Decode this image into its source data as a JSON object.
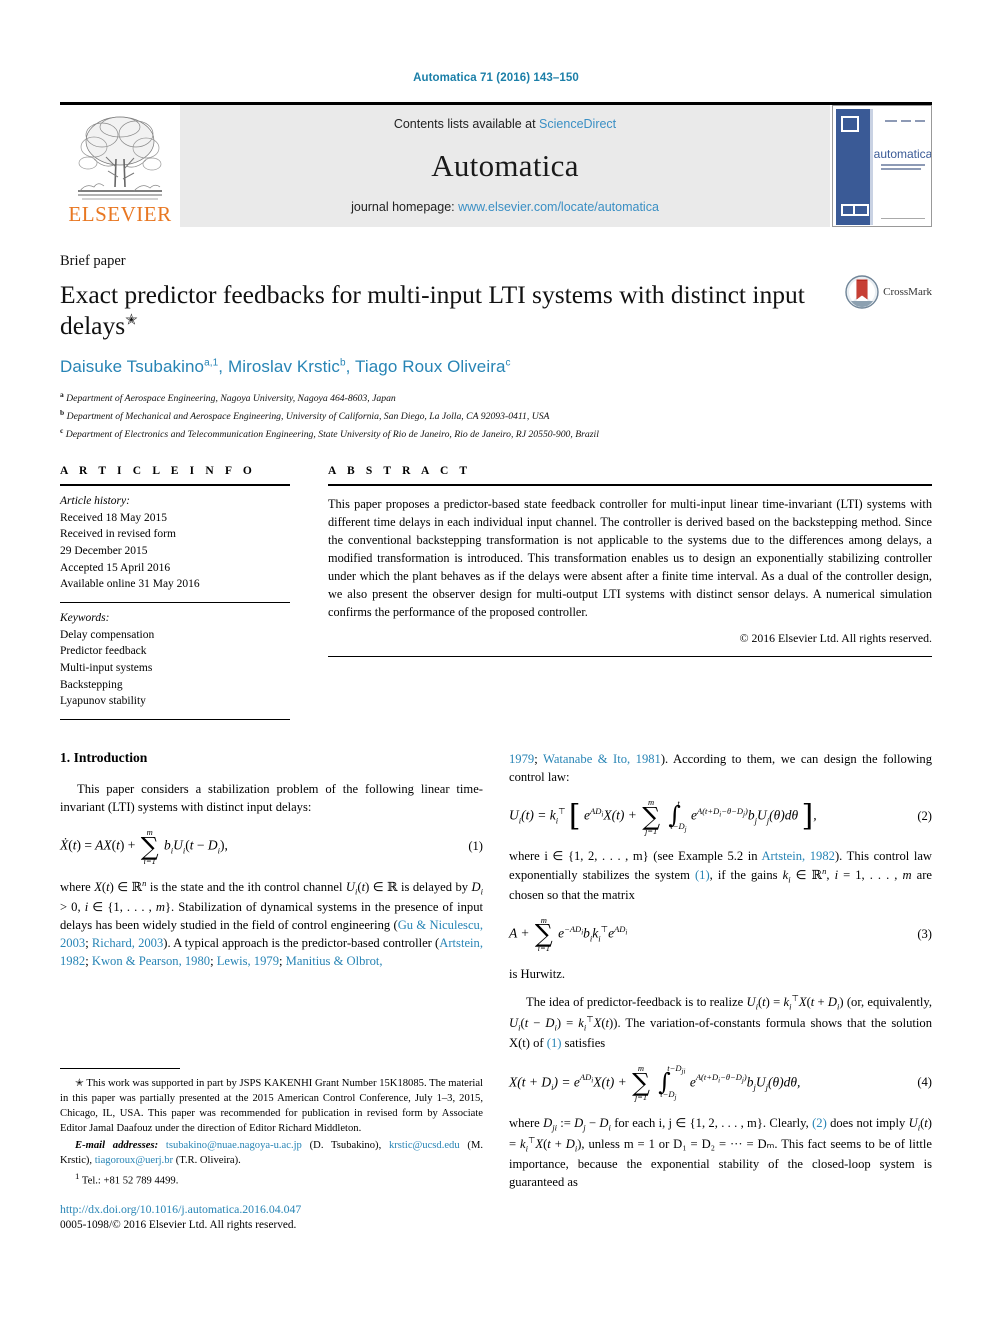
{
  "running_head": "Automatica 71 (2016) 143–150",
  "masthead": {
    "contents_prefix": "Contents lists available at ",
    "sciencedirect": "ScienceDirect",
    "journal_title": "Automatica",
    "homepage_prefix": "journal homepage: ",
    "homepage_url": "www.elsevier.com/locate/automatica",
    "publisher": "ELSEVIER",
    "cover_title": "automatica",
    "cover_subtitle": "A Journal of IFAC the International Federation of Automatic Control",
    "accent_blue": "#2784b5",
    "elsevier_orange": "#e87722"
  },
  "title_block": {
    "article_type": "Brief paper",
    "title": "Exact predictor feedbacks for multi-input LTI systems with distinct input delays",
    "title_marker": "✭",
    "crossmark_label": "CrossMark",
    "authors": [
      {
        "name": "Daisuke Tsubakino",
        "marks": "a,1"
      },
      {
        "name": "Miroslav Krstic",
        "marks": "b"
      },
      {
        "name": "Tiago Roux Oliveira",
        "marks": "c"
      }
    ],
    "affiliations": [
      {
        "mark": "a",
        "text": "Department of Aerospace Engineering, Nagoya University, Nagoya 464-8603, Japan"
      },
      {
        "mark": "b",
        "text": "Department of Mechanical and Aerospace Engineering, University of California, San Diego, La Jolla, CA 92093-0411, USA"
      },
      {
        "mark": "c",
        "text": "Department of Electronics and Telecommunication Engineering, State University of Rio de Janeiro, Rio de Janeiro, RJ 20550-900, Brazil"
      }
    ]
  },
  "article_info": {
    "heading": "A R T I C L E   I N F O",
    "history_label": "Article history:",
    "history": [
      "Received 18 May 2015",
      "Received in revised form",
      "29 December 2015",
      "Accepted 15 April 2016",
      "Available online 31 May 2016"
    ],
    "keywords_label": "Keywords:",
    "keywords": [
      "Delay compensation",
      "Predictor feedback",
      "Multi-input systems",
      "Backstepping",
      "Lyapunov stability"
    ]
  },
  "abstract": {
    "heading": "A B S T R A C T",
    "text": "This paper proposes a predictor-based state feedback controller for multi-input linear time-invariant (LTI) systems with different time delays in each individual input channel. The controller is derived based on the backstepping method. Since the conventional backstepping transformation is not applicable to the systems due to the differences among delays, a modified transformation is introduced. This transformation enables us to design an exponentially stabilizing controller under which the plant behaves as if the delays were absent after a finite time interval. As a dual of the controller design, we also present the observer design for multi-output LTI systems with distinct sensor delays. A numerical simulation confirms the performance of the proposed controller.",
    "copyright": "© 2016 Elsevier Ltd. All rights reserved."
  },
  "body": {
    "section1_title": "1. Introduction",
    "left": {
      "para1_a": "This paper considers a stabilization problem of the following linear time-invariant (LTI) systems with distinct input delays:",
      "eq1_num": "(1)",
      "para2_a": "where ",
      "para2_b": " is the state and the ith control channel ",
      "para2_c": " is delayed by ",
      "para2_d": ". Stabilization of dynamical systems in the presence of input delays has been widely studied in the field of control engineering (",
      "ref_gu": "Gu & Niculescu, 2003",
      "ref_richard": "Richard, 2003",
      "para2_e": "). A typical approach is the predictor-based controller (",
      "ref_artstein": "Artstein, 1982",
      "ref_kwon": "Kwon & Pearson, 1980",
      "ref_lewis": "Lewis, 1979",
      "ref_manitius": "Manitius & Olbrot,"
    },
    "right": {
      "cont_year": "1979",
      "ref_watanabe": "Watanabe & Ito, 1981",
      "para1_tail": "). According to them, we can design the following control law:",
      "eq2_num": "(2)",
      "para2_a": "where i ∈ {1, 2, . . . , m} (see Example 5.2 in ",
      "ref_artstein2": "Artstein, 1982",
      "para2_b": "). This control law exponentially stabilizes the system ",
      "ref_eq1": "(1)",
      "para2_c": ", if the gains ",
      "para2_d": " are chosen so that the matrix",
      "eq3_num": "(3)",
      "para3": "is Hurwitz.",
      "para4_a": "The idea of predictor-feedback is to realize ",
      "para4_b": " (or, equivalently, ",
      "para4_c": "). The variation-of-constants formula shows that the solution X(t) of ",
      "ref_eq1b": "(1)",
      "para4_d": " satisfies",
      "eq4_num": "(4)",
      "para5_a": "where ",
      "para5_b": " for each i, j ∈ {1, 2, . . . , m}. Clearly, ",
      "ref_eq2": "(2)",
      "para5_c": " does not imply ",
      "para5_d": ", unless m = 1 or D₁ = D₂ = ··· = Dₘ. This fact seems to be of little importance, because the exponential stability of the closed-loop system is guaranteed as"
    }
  },
  "footnotes": {
    "star_marker": "✭",
    "ack": "This work was supported in part by JSPS KAKENHI Grant Number 15K18085. The material in this paper was partially presented at the 2015 American Control Conference, July 1–3, 2015, Chicago, IL, USA. This paper was recommended for publication in revised form by Associate Editor Jamal Daafouz under the direction of Editor Richard Middleton.",
    "email_label": "E-mail addresses:",
    "emails": [
      {
        "addr": "tsubakino@nuae.nagoya-u.ac.jp",
        "who": "(D. Tsubakino)"
      },
      {
        "addr": "krstic@ucsd.edu",
        "who": "(M. Krstic)"
      },
      {
        "addr": "tiagoroux@uerj.br",
        "who": "(T.R. Oliveira)"
      }
    ],
    "tel_marker": "1",
    "tel": "Tel.: +81 52 789 4499.",
    "doi": "http://dx.doi.org/10.1016/j.automatica.2016.04.047",
    "issn": "0005-1098/© 2016 Elsevier Ltd. All rights reserved."
  }
}
